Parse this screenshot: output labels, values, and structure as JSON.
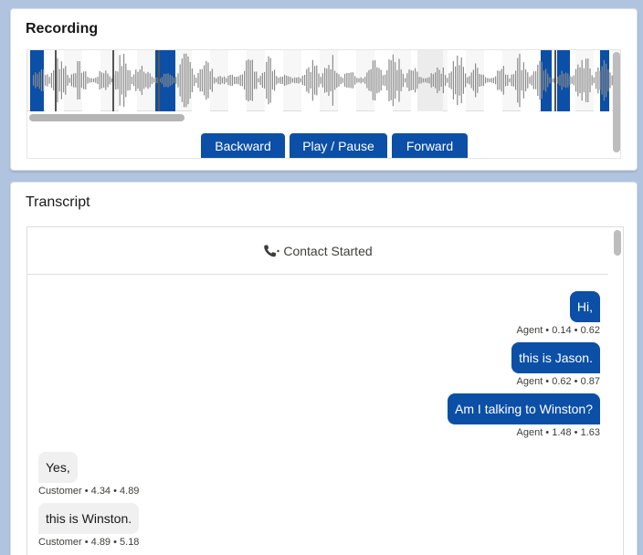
{
  "recording": {
    "title": "Recording",
    "controls": {
      "backward_label": "Backward",
      "play_pause_label": "Play / Pause",
      "forward_label": "Forward"
    }
  },
  "transcript": {
    "title": "Transcript",
    "contact_started": "Contact Started",
    "messages": [
      {
        "speaker": "agent",
        "text": "Hi,",
        "meta": "Agent • 0.14 • 0.62"
      },
      {
        "speaker": "agent",
        "text": "this is Jason.",
        "meta": "Agent • 0.62 • 0.87"
      },
      {
        "speaker": "agent",
        "text": "Am I talking to Winston?",
        "meta": "Agent • 1.48 • 1.63"
      },
      {
        "speaker": "customer",
        "text": "Yes,",
        "meta": "Customer • 4.34 • 4.89"
      },
      {
        "speaker": "customer",
        "text": "this is Winston.",
        "meta": "Customer • 4.89 • 5.18"
      }
    ]
  },
  "colors": {
    "accent": "#0b4fa6",
    "background": "#b0c4df",
    "customer_bubble": "#f0f0f0"
  },
  "icons": {
    "contact_started": "phone-icon"
  }
}
